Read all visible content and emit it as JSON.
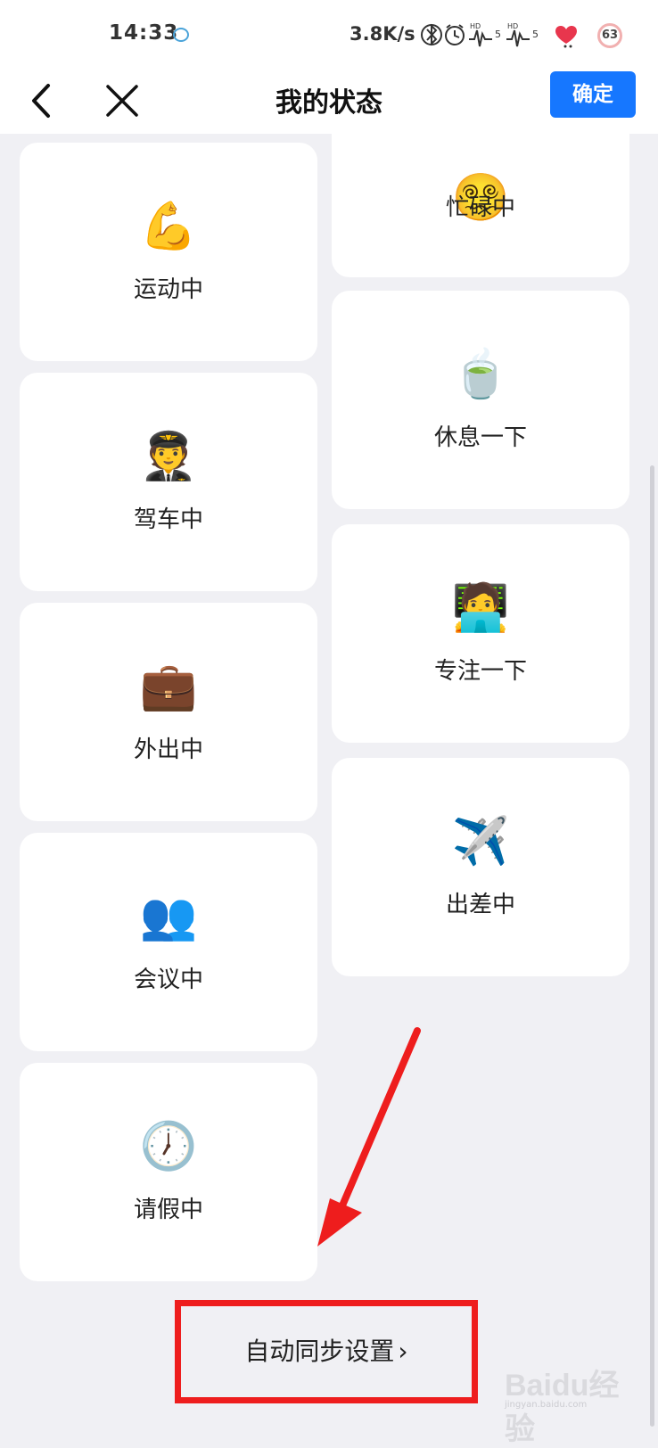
{
  "status_bar": {
    "time": "14:33",
    "net_speed": "3.8K/s",
    "battery": "63",
    "icons": [
      "chat-bubble-icon",
      "bluetooth-icon",
      "alarm-icon",
      "hd-signal-icon",
      "hd-signal-icon",
      "heart-icon"
    ]
  },
  "nav": {
    "title": "我的状态",
    "confirm_label": "确定",
    "confirm_color": "#1677ff"
  },
  "statuses_left": [
    {
      "emoji": "💪",
      "label": "运动中"
    },
    {
      "emoji": "🧑‍✈️",
      "label": "驾车中"
    },
    {
      "emoji": "💼",
      "label": "外出中"
    },
    {
      "emoji": "👥",
      "label": "会议中"
    },
    {
      "emoji": "🕖",
      "label": "请假中"
    }
  ],
  "statuses_right": [
    {
      "emoji": "😵‍💫",
      "label": "忙碌中"
    },
    {
      "emoji": "🍵",
      "label": "休息一下"
    },
    {
      "emoji": "🧑‍💻",
      "label": "专注一下"
    },
    {
      "emoji": "✈️",
      "label": "出差中"
    }
  ],
  "sync": {
    "label": "自动同步设置",
    "chevron": "›"
  },
  "annotation_color": "#ee1d1d",
  "watermark": {
    "text": "Baidu经验",
    "sub": "jingyan.baidu.com"
  }
}
